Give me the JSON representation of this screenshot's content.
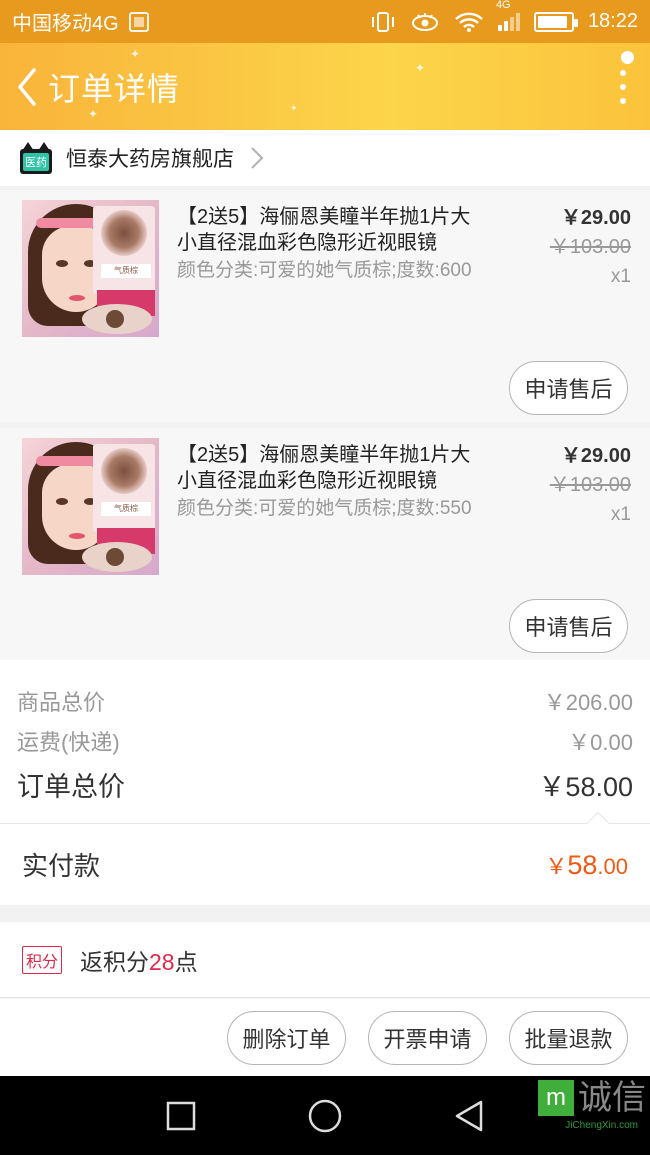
{
  "status_bar": {
    "carrier": "中国移动4G",
    "network_badge": "4G",
    "time": "18:22"
  },
  "header": {
    "title": "订单详情"
  },
  "shop": {
    "badge_text": "医药",
    "name": "恒泰大药房旗舰店"
  },
  "items": [
    {
      "title": "【2送5】海俪恩美瞳半年抛1片大小直径混血彩色隐形近视眼镜",
      "sku": "颜色分类:可爱的她气质棕;度数:600",
      "price": "￥29.00",
      "original_price": "￥103.00",
      "quantity": "x1",
      "image_tag": "气质棕",
      "after_sale_label": "申请售后"
    },
    {
      "title": "【2送5】海俪恩美瞳半年抛1片大小直径混血彩色隐形近视眼镜",
      "sku": "颜色分类:可爱的她气质棕;度数:550",
      "price": "￥29.00",
      "original_price": "￥103.00",
      "quantity": "x1",
      "image_tag": "气质棕",
      "after_sale_label": "申请售后"
    }
  ],
  "summary": {
    "goods_total_label": "商品总价",
    "goods_total": "￥206.00",
    "shipping_label": "运费(快递)",
    "shipping": "￥0.00",
    "order_total_label": "订单总价",
    "order_total": "￥58.00"
  },
  "payment": {
    "label": "实付款",
    "currency": "￥",
    "integer": "58",
    "decimal": ".00"
  },
  "points": {
    "tag": "积分",
    "prefix": "返积分",
    "count": "28",
    "suffix": "点"
  },
  "actions": {
    "delete_order": "删除订单",
    "invoice": "开票申请",
    "bulk_refund": "批量退款"
  },
  "watermark": {
    "mark": "m",
    "text": "诚信",
    "sub": "JiChengXin.com"
  },
  "colors": {
    "status_bar": "#e89a1e",
    "header_gradient_start": "#f9b43a",
    "header_gradient_end": "#fcd54a",
    "payment_amount": "#f05a12",
    "points_accent": "#e0284a"
  }
}
